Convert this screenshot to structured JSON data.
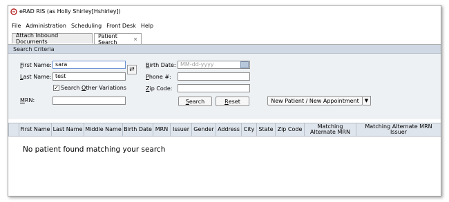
{
  "window": {
    "title": "eRAD RIS (as Holly Shirley[Hshirley])"
  },
  "menu": [
    "File",
    "Administration",
    "Scheduling",
    "Front Desk",
    "Help"
  ],
  "tabs": [
    {
      "label": "Attach Inbound Documents"
    },
    {
      "label": "Patient Search",
      "close": "×"
    }
  ],
  "section": {
    "title": "Search Criteria"
  },
  "form": {
    "first_name": {
      "label_pre": "",
      "label_key": "F",
      "label_post": "irst Name:",
      "value": "sara"
    },
    "last_name": {
      "label_pre": "",
      "label_key": "L",
      "label_post": "ast Name:",
      "value": "test"
    },
    "search_variations": {
      "label_pre": "Search ",
      "label_key": "O",
      "label_post": "ther Variations",
      "checked": true,
      "mark": "✓"
    },
    "mrn": {
      "label_pre": "",
      "label_key": "M",
      "label_post": "RN:",
      "value": ""
    },
    "birth_date": {
      "label_pre": "",
      "label_key": "B",
      "label_post": "irth Date:",
      "placeholder": "MM-dd-yyyy"
    },
    "phone": {
      "label_pre": "",
      "label_key": "P",
      "label_post": "hone #:",
      "value": ""
    },
    "zip": {
      "label_pre": "",
      "label_key": "Z",
      "label_post": "ip Code:",
      "value": ""
    },
    "search_button": {
      "pre": "",
      "key": "S",
      "post": "earch"
    },
    "reset_button": {
      "pre": "",
      "key": "R",
      "post": "eset"
    },
    "new_patient_button": "New Patient / New Appointment",
    "dropdown_arrow": "▼"
  },
  "table": {
    "columns": [
      "First Name",
      "Last Name",
      "Middle Name",
      "Birth Date",
      "MRN",
      "Issuer",
      "Gender",
      "Address",
      "City",
      "State",
      "Zip Code",
      "Matching Alternate MRN",
      "Matching Alternate MRN Issuer"
    ],
    "empty_message": "No patient found matching your search"
  }
}
